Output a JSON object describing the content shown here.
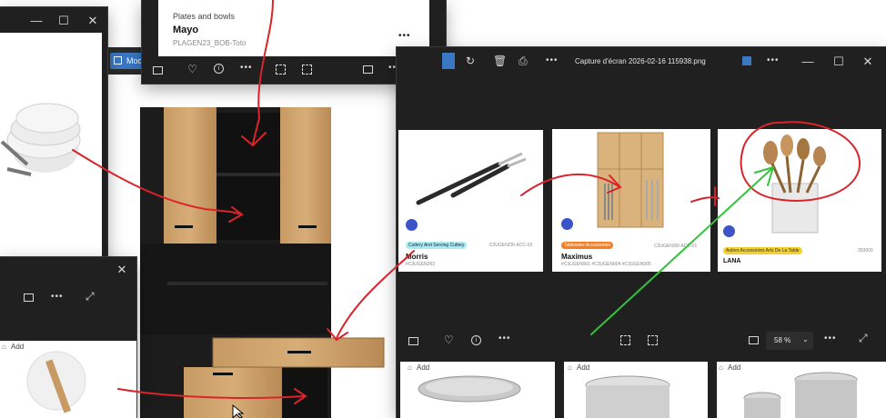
{
  "background_window": {
    "badge": "Mod"
  },
  "left_window": {
    "controls": {
      "minimize": "—",
      "maximize": "☐",
      "close": "✕"
    },
    "menu": "•••"
  },
  "product_window": {
    "category": "Plates and bowls",
    "name": "Mayo",
    "ref": "PLAGEN23_BOB-Toto",
    "menu": "•••"
  },
  "small_window": {
    "close": "✕",
    "menu": "•••",
    "add_label": "Add"
  },
  "photos_viewer": {
    "title": "Capture d'écran 2026-02-16 115938.png",
    "zoom": "58 %",
    "controls": {
      "minimize": "—",
      "maximize": "☐",
      "close": "✕"
    },
    "menu": "•••",
    "products": [
      {
        "tag": "Cutlery And Serving Cutlery",
        "tag_color": "#a8ecec",
        "code": "C3UGEN29I-ACC-02",
        "name": "Morris",
        "sub": "#C3UGEN283"
      },
      {
        "tag": "Tableware Accessories",
        "tag_color": "#f57e22",
        "code": "C3UGEN30I-ACC-01",
        "name": "Maximus",
        "sub": "#C3UGEN001   #C3UGEN004   #C3UGEN005"
      },
      {
        "tag": "Autres Accessoires Arts De La Table",
        "tag_color": "#f5d028",
        "code": "303000",
        "name": "LANA",
        "sub": ""
      }
    ],
    "add_labels": [
      "Add",
      "Add",
      "Add"
    ]
  },
  "colors": {
    "annotation_red": "#d8242a",
    "annotation_green": "#33c23a",
    "window_dark": "#202020"
  }
}
